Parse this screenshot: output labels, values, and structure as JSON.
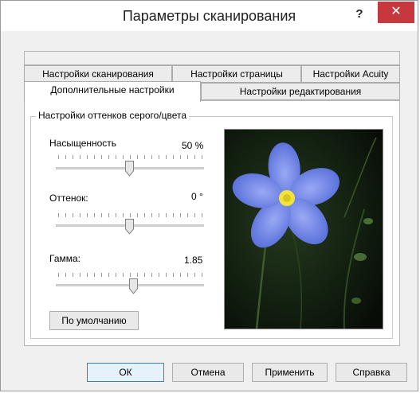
{
  "window": {
    "title": "Параметры сканирования",
    "help_label": "?",
    "close_label": "✕"
  },
  "tabs": {
    "row1": [
      "Настройки сканирования",
      "Настройки страницы",
      "Настройки Acuity"
    ],
    "row2": [
      "Дополнительные настройки",
      "Настройки редактирования"
    ],
    "active": "Дополнительные настройки"
  },
  "group": {
    "title": "Настройки оттенков серого/цвета"
  },
  "sliders": [
    {
      "label": "Насыщенность",
      "value_text": "50 %",
      "position": 0.5
    },
    {
      "label": "Оттенок:",
      "value_text": "0 °",
      "position": 0.5
    },
    {
      "label": "Гамма:",
      "value_text": "1.85",
      "position": 0.52
    }
  ],
  "buttons": {
    "default_label": "По умолчанию",
    "ok": "ОК",
    "cancel": "Отмена",
    "apply": "Применить",
    "help": "Справка"
  },
  "colors": {
    "close": "#c7383e",
    "flower": "#6c86e6",
    "flower_center": "#f2e33c"
  },
  "icons": {
    "close": "close-icon",
    "help": "help-icon"
  }
}
